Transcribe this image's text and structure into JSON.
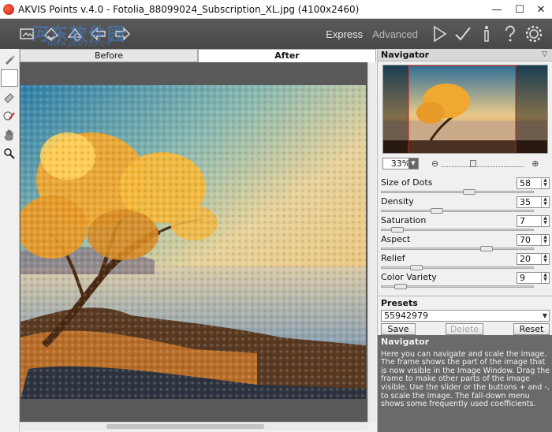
{
  "window": {
    "title": "AKVIS Points v.4.0 - Fotolia_88099024_Subscription_XL.jpg (4100x2460)",
    "minimize": "—",
    "maximize": "☐",
    "close": "✕"
  },
  "watermark": {
    "line1": "河东软件园",
    "line2": "www.pc0359.cn"
  },
  "toolbar": {
    "icons": [
      "open-image-icon",
      "save-image-icon",
      "settings-image-icon",
      "undo-arrow-icon",
      "redo-arrow-icon"
    ],
    "mode_express": "Express",
    "mode_advanced": "Advanced",
    "right_icons": [
      "run-icon",
      "apply-check-icon",
      "info-icon",
      "help-icon",
      "gear-icon"
    ]
  },
  "tabs": {
    "before": "Before",
    "after": "After"
  },
  "navigator": {
    "title": "Navigator",
    "zoom": "33%"
  },
  "params": [
    {
      "label": "Size of Dots",
      "value": "58",
      "pos": 0.58
    },
    {
      "label": "Density",
      "value": "35",
      "pos": 0.35
    },
    {
      "label": "Saturation",
      "value": "7",
      "pos": 0.07
    },
    {
      "label": "Aspect",
      "value": "70",
      "pos": 0.7
    },
    {
      "label": "Relief",
      "value": "20",
      "pos": 0.2
    },
    {
      "label": "Color Variety",
      "value": "9",
      "pos": 0.09
    }
  ],
  "presets": {
    "title": "Presets",
    "selected": "55942979",
    "save": "Save",
    "delete": "Delete",
    "reset": "Reset"
  },
  "help": {
    "title": "Navigator",
    "text": "Here you can navigate and scale the image. The frame shows the part of the image that is now visible in the Image Window. Drag the frame to make other parts of the image visible. Use the slider or the buttons + and -, to scale the image. The fall-down menu shows some frequently used coefficients."
  },
  "colors": {
    "toolbar": "#4f4f4f",
    "help_bg": "#6a6a6a",
    "accent": "#c01818"
  }
}
